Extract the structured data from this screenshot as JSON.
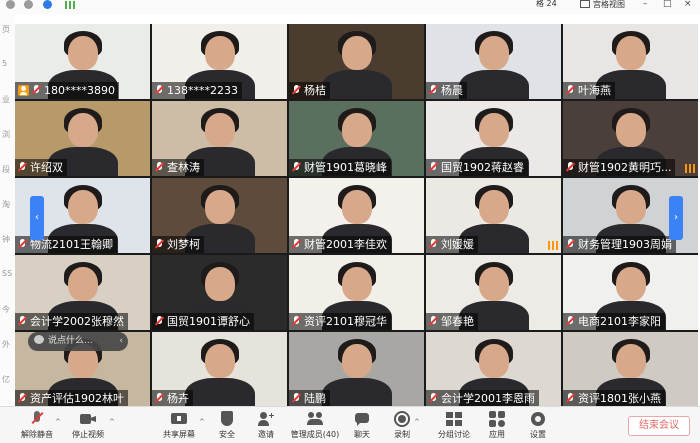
{
  "topbar": {
    "grid_label": "格 24",
    "grid_view_label": "宫格视图"
  },
  "sidebar": {
    "fragments": [
      "页",
      "5",
      "业",
      "浏",
      "段",
      "淘",
      "钟",
      "SS",
      "今",
      "外",
      "亿"
    ]
  },
  "grid": {
    "rows": [
      [
        {
          "name": "180****3890",
          "host": true,
          "bg": "#e9ece9"
        },
        {
          "name": "138****2233",
          "host": false,
          "bg": "#f1efe9"
        },
        {
          "name": "杨桔",
          "host": false,
          "bg": "#4a3c2e"
        },
        {
          "name": "杨晨",
          "host": false,
          "bg": "#dfe2e6"
        },
        {
          "name": "叶海燕",
          "host": false,
          "bg": "#e8e6e4"
        }
      ],
      [
        {
          "name": "许绍双",
          "host": false,
          "bg": "#b89a6a"
        },
        {
          "name": "查林涛",
          "host": false,
          "bg": "#cdbca6"
        },
        {
          "name": "财管1901葛晓峰",
          "host": false,
          "bg": "#5b6f5e"
        },
        {
          "name": "国贸1902蒋赵睿",
          "host": false,
          "bg": "#ece8e8"
        },
        {
          "name": "财管1902黄明巧...",
          "host": false,
          "bg": "#4a3f3a",
          "bars": true
        }
      ],
      [
        {
          "name": "物流2101王翰卿",
          "host": false,
          "bg": "#dfe3ea"
        },
        {
          "name": "刘梦柯",
          "host": false,
          "bg": "#5f4b3c"
        },
        {
          "name": "财管2001李佳欢",
          "host": false,
          "bg": "#f4f1ec"
        },
        {
          "name": "刘媛媛",
          "host": false,
          "bg": "#ece9e4",
          "bars": true
        },
        {
          "name": "财务管理1903周娟",
          "host": false,
          "bg": "#cfd3d6"
        }
      ],
      [
        {
          "name": "会计学2002张穆然",
          "host": false,
          "bg": "#d8d0c4"
        },
        {
          "name": "国贸1901谭舒心",
          "host": false,
          "bg": "#2b2b2b"
        },
        {
          "name": "资评2101穆冠华",
          "host": false,
          "bg": "#f1efe8"
        },
        {
          "name": "邹春艳",
          "host": false,
          "bg": "#ecebe6"
        },
        {
          "name": "电商2101李家阳",
          "host": false,
          "bg": "#f0f0ee"
        }
      ],
      [
        {
          "name": "资产评估1902林叶",
          "host": false,
          "bg": "#c6b7a0"
        },
        {
          "name": "杨卉",
          "host": false,
          "bg": "#e6e3dc"
        },
        {
          "name": "陆鹏",
          "host": false,
          "bg": "#a9a7a4"
        },
        {
          "name": "会计学2001李恩雨",
          "host": false,
          "bg": "#ddd9d2"
        },
        {
          "name": "资评1801张小燕",
          "host": false,
          "bg": "#cfcac4"
        }
      ]
    ]
  },
  "chat": {
    "placeholder": "说点什么..."
  },
  "toolbar": {
    "unmute": "解除静音",
    "stop_video": "停止视频",
    "share_screen": "共享屏幕",
    "security": "安全",
    "invite": "邀请",
    "members": "管理成员(40)",
    "chat": "聊天",
    "record": "录制",
    "breakout": "分组讨论",
    "apps": "应用",
    "settings": "设置",
    "end_meeting": "结束会议"
  },
  "colors": {
    "accent": "#3b82f6",
    "muted_red": "#e53935",
    "end_red": "#e26a6a"
  }
}
